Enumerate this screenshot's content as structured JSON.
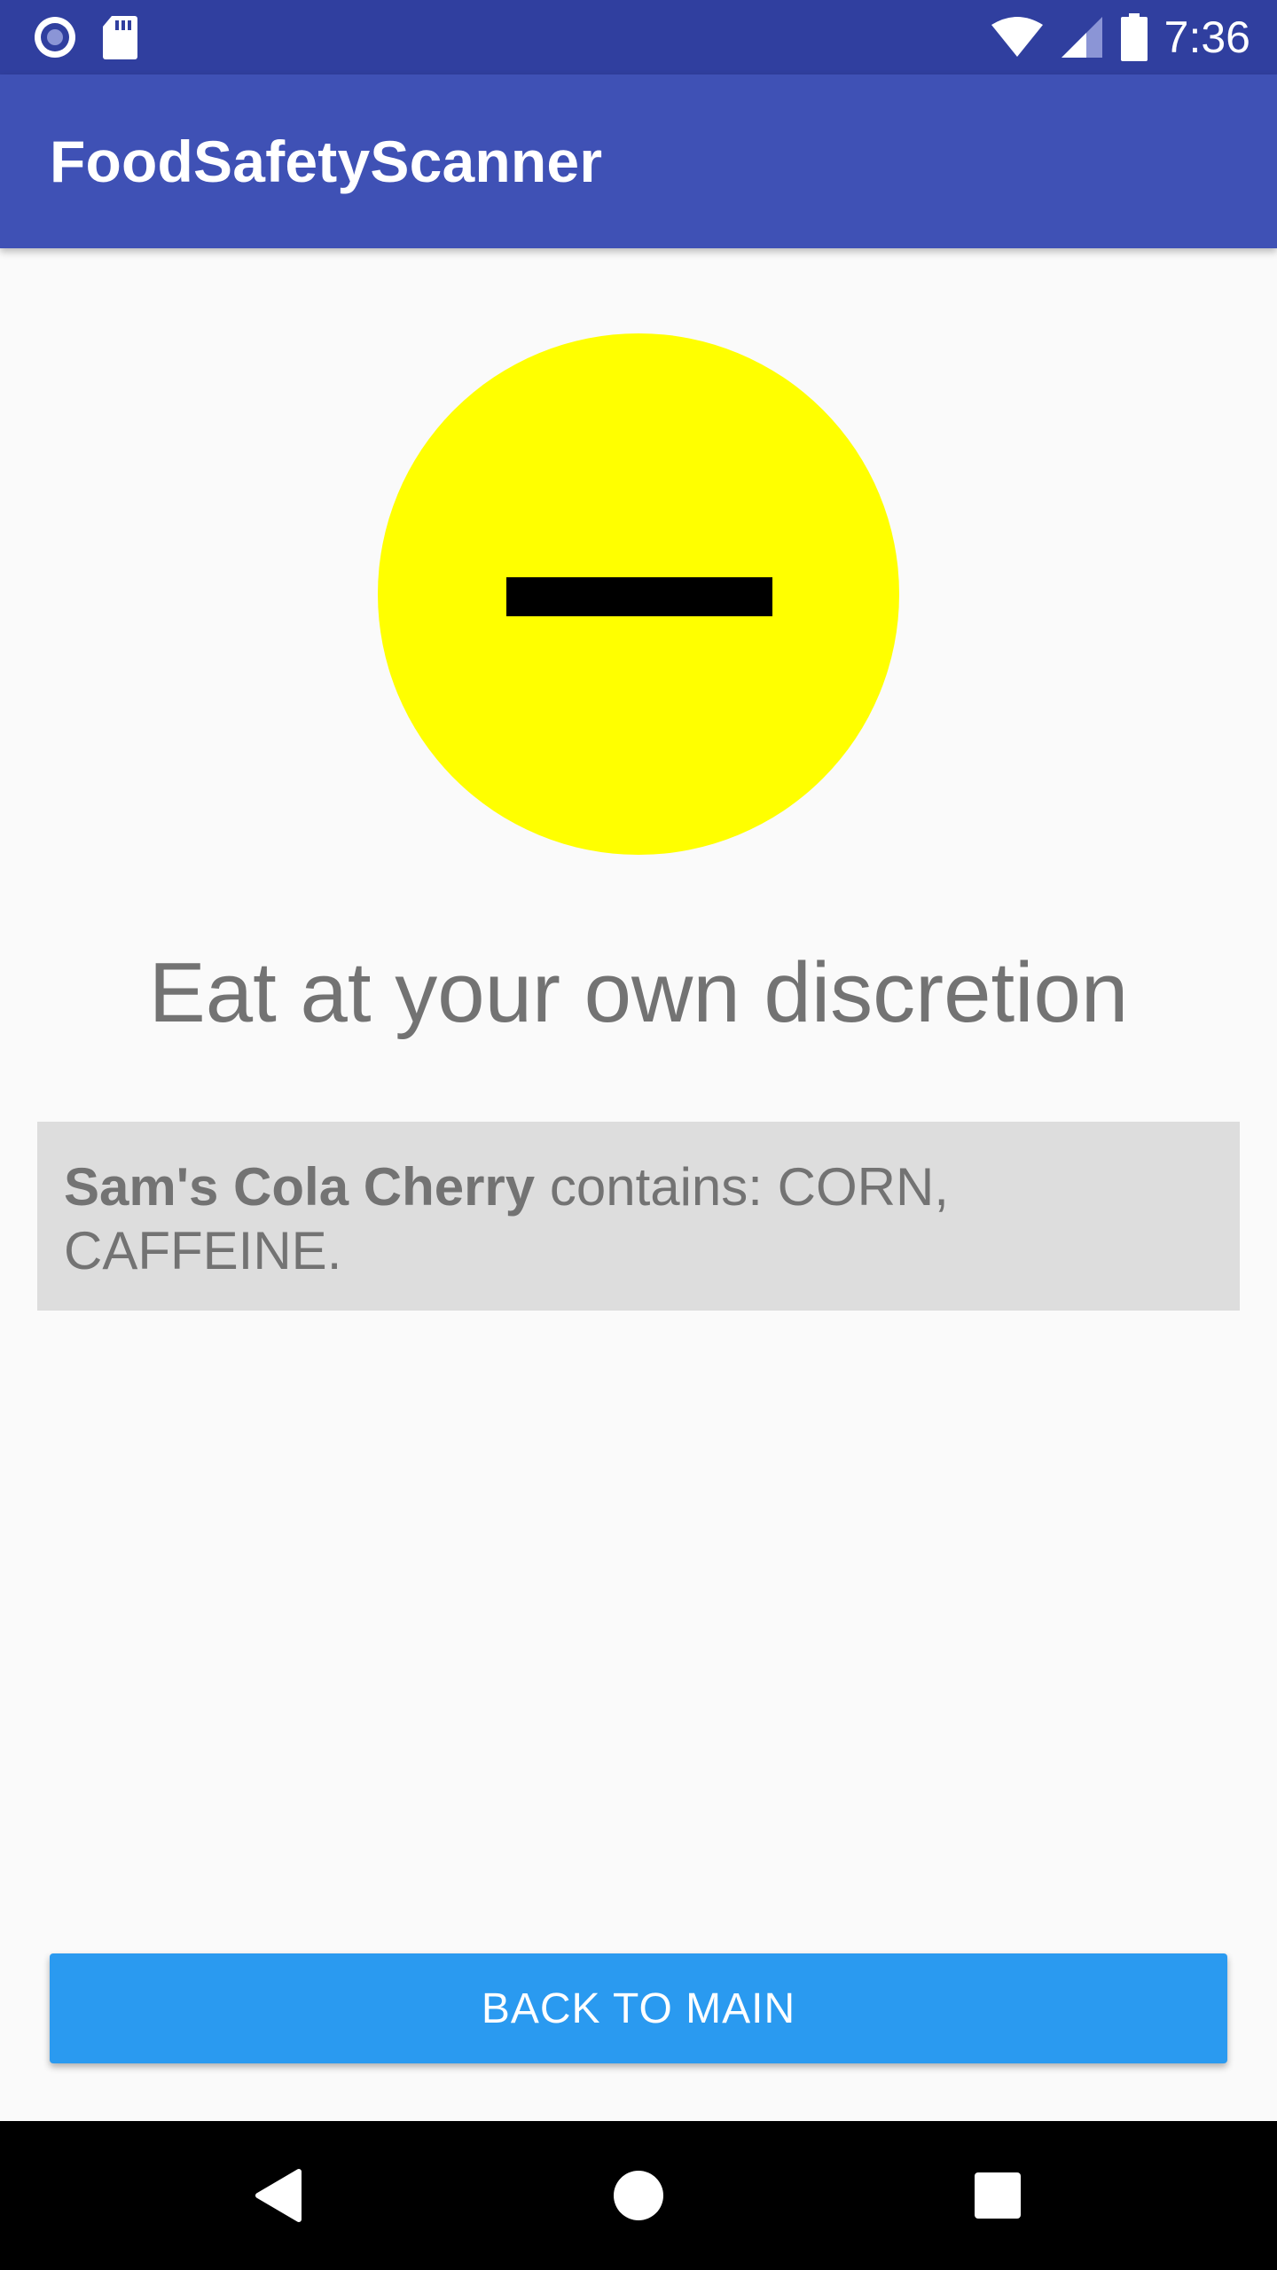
{
  "status_bar": {
    "time": "7:36",
    "icons": [
      "radio-icon",
      "sd-card-icon",
      "wifi-icon",
      "signal-icon",
      "battery-icon"
    ]
  },
  "app_bar": {
    "title": "FoodSafetyScanner"
  },
  "result": {
    "face_icon": "neutral-face-icon",
    "face_color": "#ffff00",
    "verdict": "Eat at your own discretion",
    "product_name": "Sam's Cola Cherry",
    "ingredients_text": " contains: CORN, CAFFEINE."
  },
  "actions": {
    "back_label": "BACK TO MAIN",
    "button_color": "#2a9af0"
  },
  "nav_bar": {
    "icons": [
      "back-icon",
      "home-icon",
      "recents-icon"
    ]
  },
  "colors": {
    "status_bar": "#303f9f",
    "app_bar": "#3f51b5",
    "panel": "#dddddd",
    "text_gray": "#737373"
  }
}
